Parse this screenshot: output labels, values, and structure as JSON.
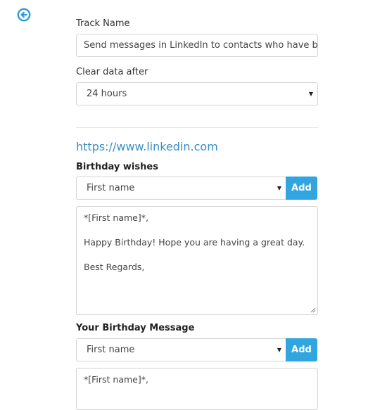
{
  "header": {
    "back_icon": "circle-arrow-left-icon",
    "accent": "#2f9cdc"
  },
  "form": {
    "track_name_label": "Track Name",
    "track_name_value": "Send messages in LinkedIn to contacts who have birthday",
    "clear_data_label": "Clear data after",
    "clear_data_value": "24 hours",
    "site_url": "https://www.linkedin.com"
  },
  "birthday_wishes": {
    "label": "Birthday wishes",
    "placeholder_select": "First name",
    "add_label": "Add",
    "message_lines": [
      "*[First name]*,",
      "Happy Birthday! Hope you are having a great day.",
      "Best Regards,"
    ]
  },
  "your_message": {
    "label": "Your Birthday Message",
    "placeholder_select": "First name",
    "add_label": "Add",
    "message_lines": [
      "*[First name]*,"
    ]
  },
  "colors": {
    "add_button": "#31a5df",
    "link": "#3a8ec6",
    "border": "#d4d4d4"
  }
}
